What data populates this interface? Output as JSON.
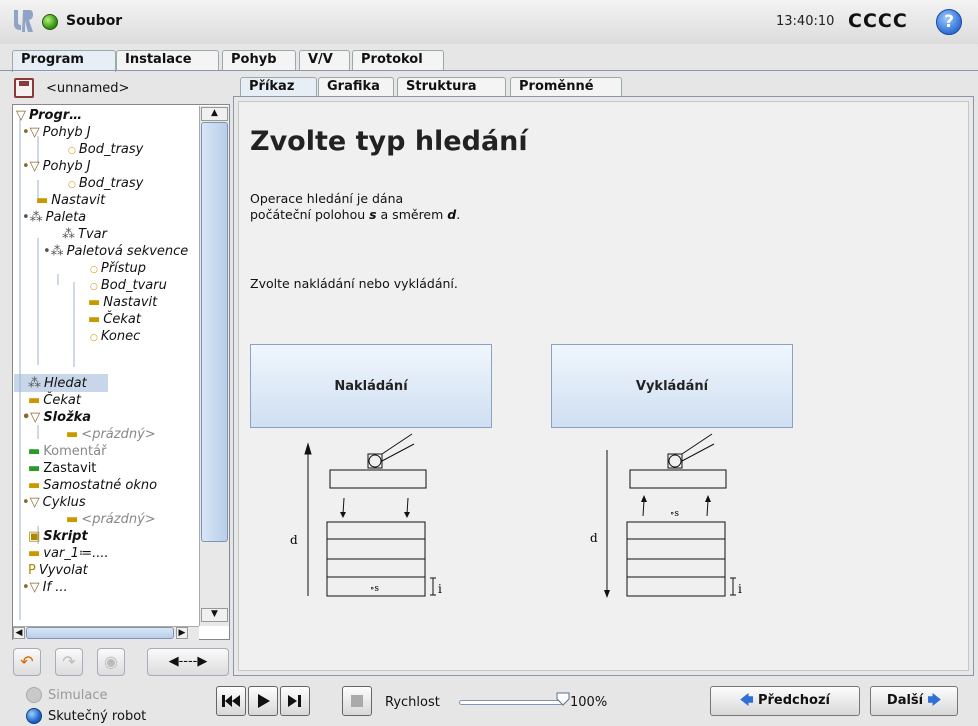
{
  "header": {
    "menu_title": "Soubor",
    "time": "13:40:10",
    "robot_name": "CCCC",
    "help_symbol": "?"
  },
  "main_tabs": [
    "Program",
    "Instalace",
    "Pohyb",
    "V/V",
    "Protokol"
  ],
  "program": {
    "name": "<unnamed>",
    "tree": [
      {
        "label": "Progr…"
      },
      {
        "label": "Pohyb J"
      },
      {
        "label": "Bod_trasy"
      },
      {
        "label": "Pohyb J"
      },
      {
        "label": "Bod_trasy"
      },
      {
        "label": "Nastavit"
      },
      {
        "label": "Paleta"
      },
      {
        "label": "Tvar"
      },
      {
        "label": "Paletová sekvence"
      },
      {
        "label": "Přístup"
      },
      {
        "label": "Bod_tvaru"
      },
      {
        "label": "Nastavit"
      },
      {
        "label": "Čekat"
      },
      {
        "label": "Konec"
      },
      {
        "label": "Hledat"
      },
      {
        "label": "Čekat"
      },
      {
        "label": "Složka"
      },
      {
        "label": "<prázdný>"
      },
      {
        "label": "Komentář"
      },
      {
        "label": "Zastavit"
      },
      {
        "label": "Samostatné okno"
      },
      {
        "label": "Cyklus"
      },
      {
        "label": "<prázdný>"
      },
      {
        "label": "Skript"
      },
      {
        "label": "var_1≔...."
      },
      {
        "label": "Vyvolat"
      },
      {
        "label": "If ..."
      }
    ]
  },
  "sub_tabs": [
    "Příkaz",
    "Grafika",
    "Struktura",
    "Proměnné"
  ],
  "content": {
    "title": "Zvolte typ hledání",
    "desc_line1": "Operace hledání je dána",
    "desc_line2_pre": "počáteční polohou ",
    "desc_s": "s",
    "desc_line2_mid": " a směrem ",
    "desc_d": "d",
    "desc_line2_post": ".",
    "prompt": "Zvolte nakládání nebo vykládání.",
    "load_button": "Nakládání",
    "unload_button": "Vykládání",
    "diagram_d": "d",
    "diagram_i": "i",
    "diagram_s": "∘s"
  },
  "footer": {
    "simulation": "Simulace",
    "real_robot": "Skutečný robot",
    "speed_label": "Rychlost",
    "speed_value": "100%",
    "speed_fraction": 1.0,
    "prev": "Předchozí",
    "next": "Další"
  }
}
